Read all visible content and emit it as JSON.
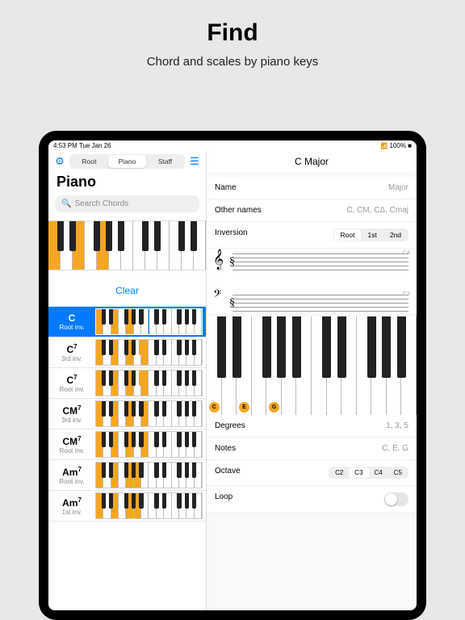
{
  "promo": {
    "title": "Find",
    "subtitle": "Chord and scales by piano keys"
  },
  "status": {
    "left": "4:53 PM   Tue Jan 26",
    "right": "100%"
  },
  "seg": {
    "root": "Root",
    "piano": "Piano",
    "staff": "Staff"
  },
  "left_title": "Piano",
  "search": {
    "placeholder": "Search Chords"
  },
  "clear": "Clear",
  "chords": [
    {
      "name": "C",
      "sup": "",
      "inv": "Root inv."
    },
    {
      "name": "C",
      "sup": "7",
      "inv": "3rd inv."
    },
    {
      "name": "C",
      "sup": "7",
      "inv": "Root inv."
    },
    {
      "name": "CM",
      "sup": "7",
      "inv": "3rd inv."
    },
    {
      "name": "CM",
      "sup": "7",
      "inv": "Root inv."
    },
    {
      "name": "Am",
      "sup": "7",
      "inv": "Root inv."
    },
    {
      "name": "Am",
      "sup": "7",
      "inv": "1st inv."
    }
  ],
  "detail": {
    "title": "C Major",
    "name_label": "Name",
    "name_value": "Major",
    "other_label": "Other names",
    "other_value": "C, CM, CΔ, Cmaj",
    "inv_label": "Inversion",
    "inv_opts": [
      "Root",
      "1st",
      "2nd"
    ],
    "staff_c4": "C4",
    "staff_c3": "C3",
    "notes": [
      "C",
      "E",
      "G"
    ],
    "deg_label": "Degrees",
    "deg_value": "1, 3, 5",
    "notes_label": "Notes",
    "notes_value": "C, E, G",
    "oct_label": "Octave",
    "oct_opts": [
      "C2",
      "C3",
      "C4",
      "C5"
    ],
    "loop_label": "Loop"
  }
}
